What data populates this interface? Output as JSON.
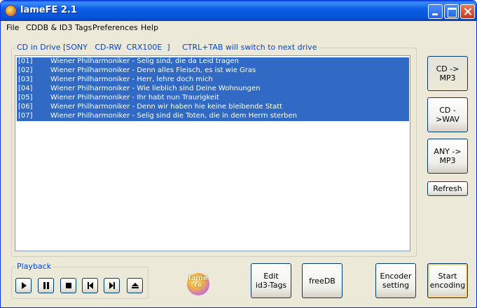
{
  "window": {
    "title": "lameFE 2.1"
  },
  "menu": [
    "File",
    "CDDB & ID3 Tags",
    "Preferences",
    "Help"
  ],
  "cd_group": {
    "label": "CD in Drive [SONY   CD-RW  CRX100E  ]     CTRL+TAB will switch to next drive",
    "tracks": [
      {
        "num": "[01]",
        "title": "Wiener Philharmoniker - Selig sind, die da Leid tragen"
      },
      {
        "num": "[02]",
        "title": "Wiener Philharmoniker - Denn alles Fleisch, es ist wie Gras"
      },
      {
        "num": "[03]",
        "title": "Wiener Philharmoniker - Herr, lehre doch mich"
      },
      {
        "num": "[04]",
        "title": "Wiener Philharmoniker - Wie lieblich sind Deine Wohnungen"
      },
      {
        "num": "[05]",
        "title": "Wiener Philharmoniker - Ihr habt nun Traurigkeit"
      },
      {
        "num": "[06]",
        "title": "Wiener Philharmoniker - Denn wir haben hie keine bleibende Statt"
      },
      {
        "num": "[07]",
        "title": "Wiener Philharmoniker - Selig sind die Toten, die in dem Herrn sterben"
      }
    ]
  },
  "side_buttons": {
    "cd_mp3": "CD -> MP3",
    "cd_wav": "CD ->WAV",
    "any_mp3": "ANY ->\nMP3",
    "refresh": "Refresh"
  },
  "playback": {
    "label": "Playback",
    "buttons": [
      "play-icon",
      "pause-icon",
      "stop-icon",
      "previous-track-icon",
      "next-track-icon",
      "eject-icon"
    ]
  },
  "logo": {
    "text": "lame\nfe"
  },
  "bottom_buttons": {
    "edit_tags": "Edit\nid3-Tags",
    "freedb": "freeDB",
    "encoder_setting": "Encoder\nsetting",
    "start_encoding": "Start\nencoding"
  },
  "colors": {
    "title_bar": "#0a5fe6",
    "selection": "#316ac5",
    "group_label": "#0046d5",
    "window_bg": "#ece9d8"
  }
}
